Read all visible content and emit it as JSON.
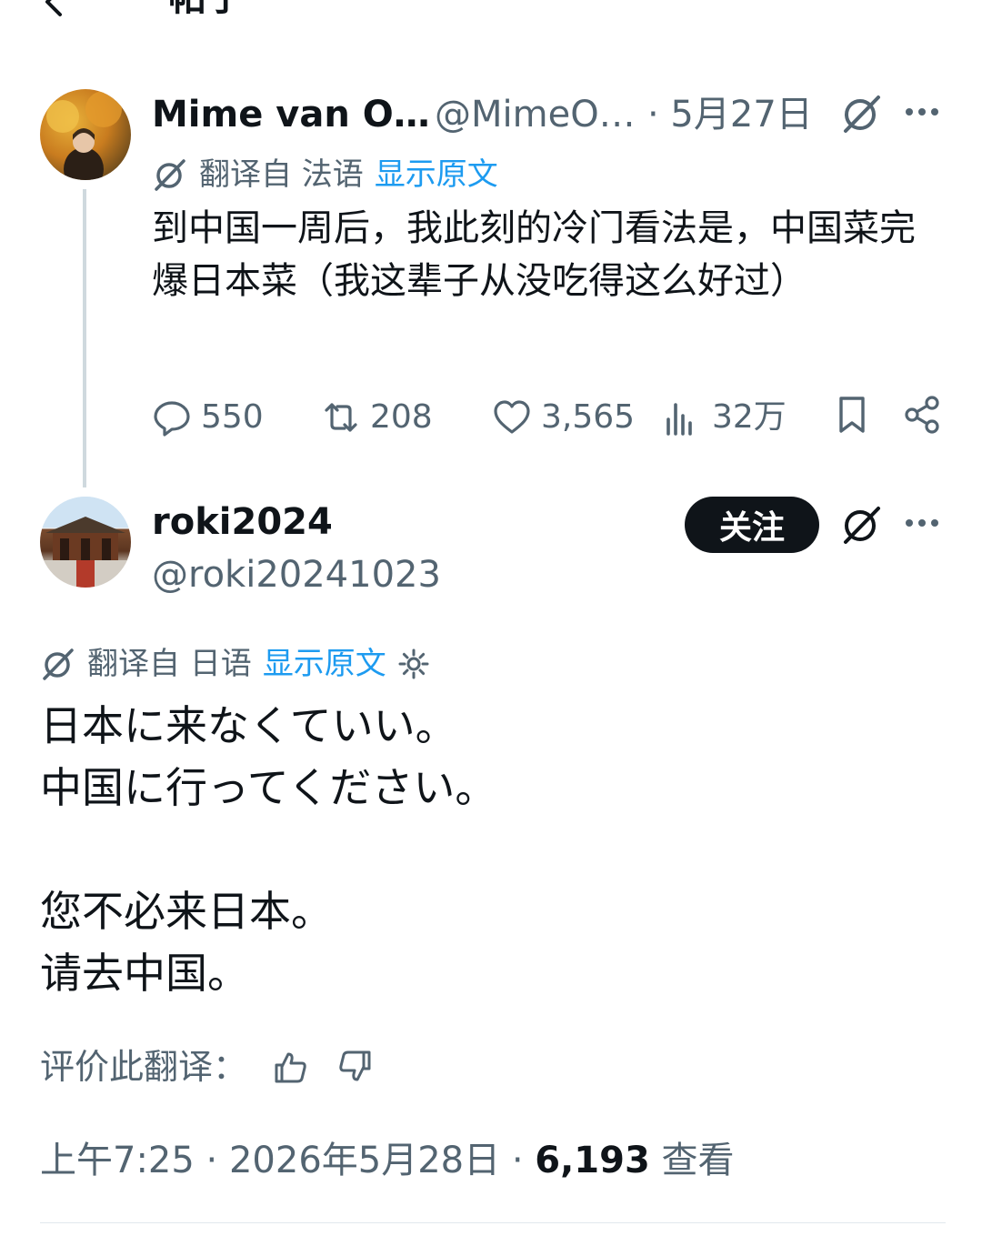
{
  "header": {
    "title": "帖子"
  },
  "tweet1": {
    "name": "Mime van O…",
    "handle": "@MimeO…",
    "date": "· 5月27日",
    "translation": {
      "label": "翻译自 法语",
      "show_original": "显示原文"
    },
    "text": "到中国一周后，我此刻的冷门看法是，中国菜完爆日本菜（我这辈子从没吃得这么好过）",
    "stats": {
      "replies": "550",
      "reposts": "208",
      "likes": "3,565",
      "views": "32万"
    }
  },
  "tweet2": {
    "name": "roki2024",
    "handle": "@roki20241023",
    "follow_label": "关注",
    "translation": {
      "label": "翻译自 日语",
      "show_original": "显示原文"
    },
    "lines": [
      "日本に来なくていい。",
      "中国に行ってください。",
      "",
      "您不必来日本。",
      "请去中国。"
    ],
    "rate_label": "评价此翻译：",
    "time": "上午7:25 · 2026年5月28日 · ",
    "views": "6,193",
    "views_label": " 查看"
  },
  "icons": [
    "back-arrow-icon",
    "grok-icon",
    "more-icon",
    "translate-icon",
    "reply-icon",
    "repost-icon",
    "like-icon",
    "views-icon",
    "bookmark-icon",
    "share-icon",
    "settings-icon",
    "thumbs-up-icon",
    "thumbs-down-icon"
  ],
  "colors": {
    "accent": "#1d9bf0",
    "text": "#0f1419",
    "muted": "#536471"
  }
}
